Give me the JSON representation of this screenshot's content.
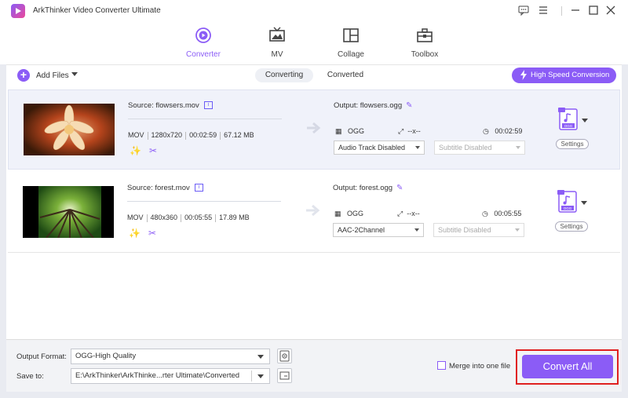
{
  "app": {
    "title": "ArkThinker Video Converter Ultimate"
  },
  "window_controls": [
    "feedback-icon",
    "menu-icon",
    "minimize-icon",
    "maximize-icon",
    "close-icon"
  ],
  "nav": {
    "tabs": [
      {
        "label": "Converter",
        "icon": "converter-icon",
        "active": true
      },
      {
        "label": "MV",
        "icon": "tv-icon",
        "active": false
      },
      {
        "label": "Collage",
        "icon": "collage-icon",
        "active": false
      },
      {
        "label": "Toolbox",
        "icon": "toolbox-icon",
        "active": false
      }
    ]
  },
  "toolbar": {
    "add_files": "Add Files",
    "tab_converting": "Converting",
    "tab_converted": "Converted",
    "high_speed": "High Speed Conversion"
  },
  "files": [
    {
      "source": "Source: flowsers.mov",
      "container": "MOV",
      "resolution": "1280x720",
      "duration": "00:02:59",
      "size": "67.12 MB",
      "output": "Output: flowsers.ogg",
      "out_format": "OGG",
      "out_resolution": "--x--",
      "out_duration": "00:02:59",
      "audio": "Audio Track Disabled",
      "subtitle": "Subtitle Disabled",
      "format_badge": "OGG",
      "settings": "Settings"
    },
    {
      "source": "Source: forest.mov",
      "container": "MOV",
      "resolution": "480x360",
      "duration": "00:05:55",
      "size": "17.89 MB",
      "output": "Output: forest.ogg",
      "out_format": "OGG",
      "out_resolution": "--x--",
      "out_duration": "00:05:55",
      "audio": "AAC-2Channel",
      "subtitle": "Subtitle Disabled",
      "format_badge": "OGG",
      "settings": "Settings"
    }
  ],
  "bottom": {
    "output_format_label": "Output Format:",
    "output_format_value": "OGG-High Quality",
    "save_to_label": "Save to:",
    "save_to_value": "E:\\ArkThinker\\ArkThinke...rter Ultimate\\Converted",
    "merge_label": "Merge into one file",
    "convert_all": "Convert All"
  },
  "colors": {
    "accent": "#8b5cf6",
    "highlight": "#e02020"
  }
}
